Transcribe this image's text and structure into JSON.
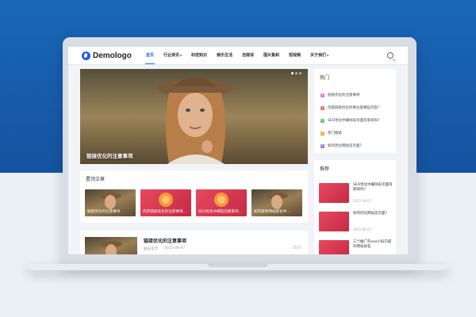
{
  "brand": {
    "name": "Demologo",
    "accent": "#1e6fe0"
  },
  "nav": {
    "items": [
      {
        "label": "首页",
        "active": true,
        "dropdown": false
      },
      {
        "label": "行业资讯",
        "active": false,
        "dropdown": true
      },
      {
        "label": "科技知识",
        "active": false,
        "dropdown": false
      },
      {
        "label": "娱乐生活",
        "active": false,
        "dropdown": false
      },
      {
        "label": "自媒体",
        "active": false,
        "dropdown": false
      },
      {
        "label": "图片集和",
        "active": false,
        "dropdown": false
      },
      {
        "label": "短视频",
        "active": false,
        "dropdown": false
      },
      {
        "label": "关于我们",
        "active": false,
        "dropdown": true
      }
    ],
    "caret": "▾",
    "search_icon": "search-icon"
  },
  "hero": {
    "caption": "链接优化的注意事项",
    "slides": 3,
    "active_slide": 1
  },
  "recommended": {
    "title": "置顶文章",
    "cards": [
      {
        "label": "链接优化的注意事项",
        "style": "woman"
      },
      {
        "label": "内页链接优化的注意事项...",
        "style": "red"
      },
      {
        "label": "SEO优化中哪些因素影响...",
        "style": "red"
      },
      {
        "label": "如何避免网站优化中...",
        "style": "woman"
      }
    ]
  },
  "post": {
    "title": "链接优化的注意事项",
    "category": "娱乐生活",
    "date": "2022-08-07",
    "views": "7577"
  },
  "sidebar_hot": {
    "title": "热门",
    "items": [
      {
        "num": "1",
        "text": "链接优化的注意事项",
        "color": "#e07ec8"
      },
      {
        "num": "2",
        "text": "内部链接优化时要注意哪些内容?",
        "color": "#ee6a6a"
      },
      {
        "num": "3",
        "text": "SEO优化中删除旧页面有影响吗?",
        "color": "#6cc56c"
      },
      {
        "num": "4",
        "text": "热门搜索",
        "color": "#f2a93b"
      },
      {
        "num": "5",
        "text": "如何优化网站首页面?",
        "color": "#9b7bd8"
      }
    ]
  },
  "sidebar_rec": {
    "title": "推荐",
    "items": [
      {
        "title": "SEO优化中删除旧页面有影响吗?",
        "date": "2022-08-07"
      },
      {
        "title": "如何优化网站首页面?",
        "date": "2022-08-07"
      },
      {
        "title": "三个推广的seo小技巧提升网站排名",
        "date": ""
      }
    ]
  }
}
